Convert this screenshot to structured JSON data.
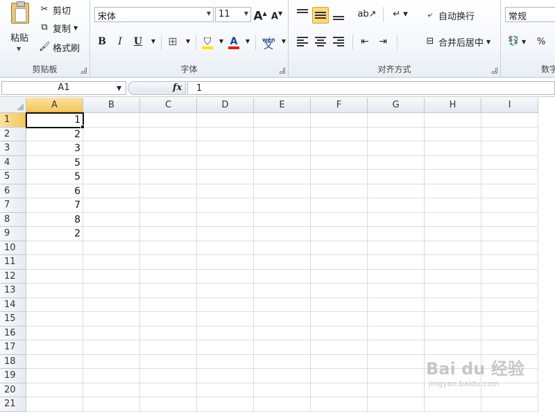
{
  "ribbon": {
    "clipboard": {
      "label": "剪贴板",
      "paste": "粘贴",
      "cut": "剪切",
      "copy": "复制",
      "format_painter": "格式刷"
    },
    "font": {
      "label": "字体",
      "font_name": "宋体",
      "font_size": "11",
      "grow_font": "A",
      "shrink_font": "A",
      "bold": "B",
      "italic": "I",
      "underline": "U",
      "font_color_letter": "A",
      "phonetic_top": "wén",
      "phonetic_char": "文",
      "font_color": "#e0201b",
      "fill_color": "#ffe600"
    },
    "alignment": {
      "label": "对齐方式",
      "wrap_text": "自动换行",
      "merge_center": "合并后居中"
    },
    "number": {
      "label": "数字",
      "format": "常规",
      "percent": "%"
    }
  },
  "formula_bar": {
    "name_box": "A1",
    "fx": "fx",
    "value": "1"
  },
  "sheet": {
    "columns": [
      "A",
      "B",
      "C",
      "D",
      "E",
      "F",
      "G",
      "H",
      "I"
    ],
    "selected_column": "A",
    "rows": [
      "1",
      "2",
      "3",
      "4",
      "5",
      "6",
      "7",
      "8",
      "9",
      "10",
      "11",
      "12",
      "13",
      "14",
      "15",
      "16",
      "17",
      "18",
      "19",
      "20",
      "21"
    ],
    "selected_row": "1",
    "column_a_values": [
      "1",
      "2",
      "3",
      "5",
      "5",
      "6",
      "7",
      "8",
      "2"
    ],
    "accent_color": "#f4c660"
  },
  "watermark": {
    "main": "Bai du 经验",
    "sub": "jingyan.baidu.com"
  }
}
